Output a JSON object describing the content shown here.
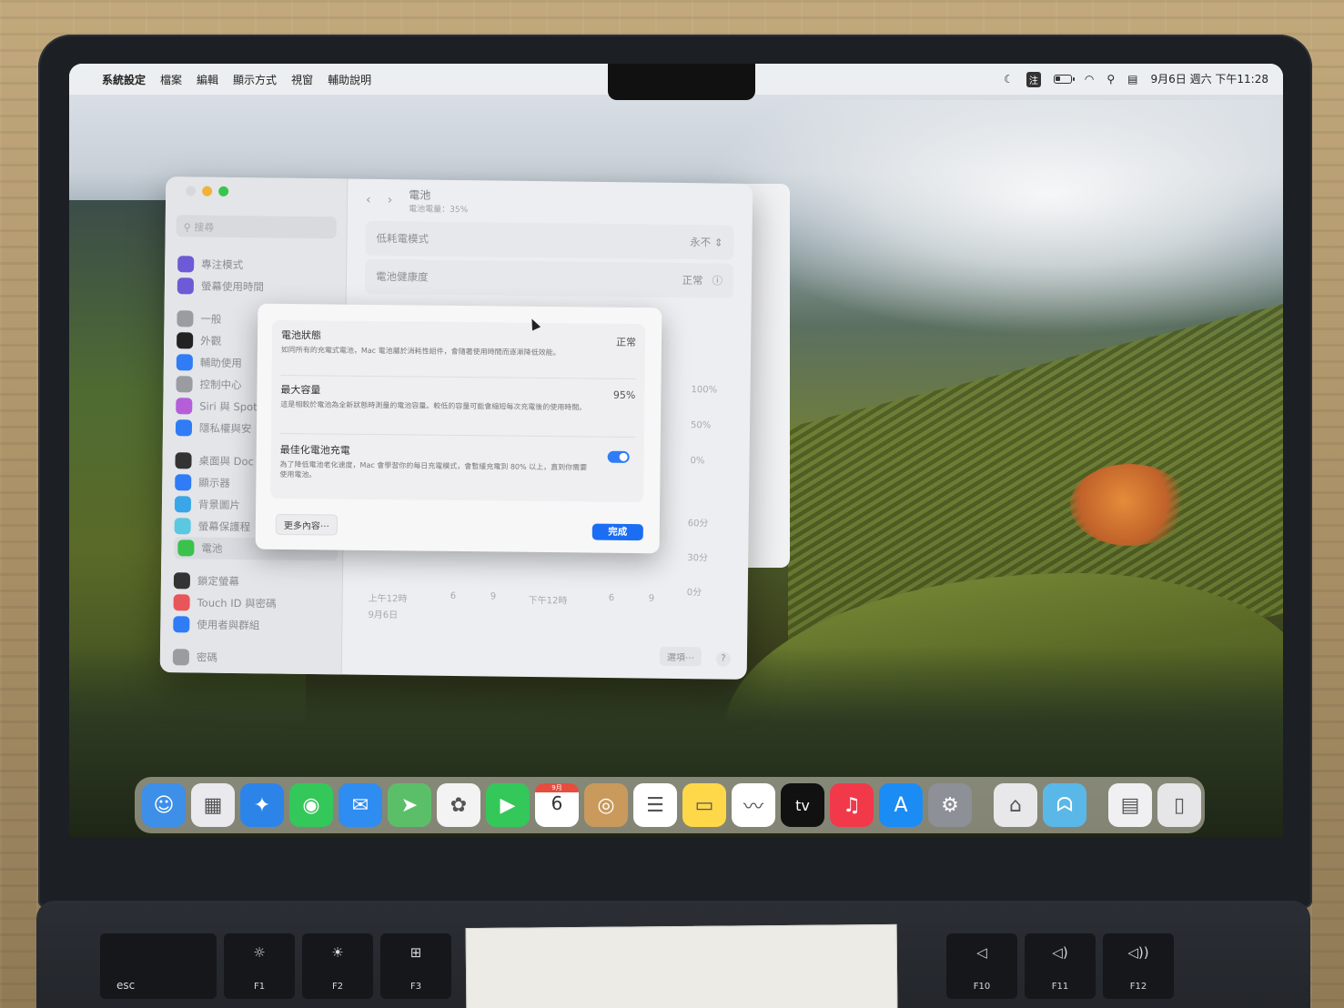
{
  "menubar": {
    "apple_icon": "apple-icon",
    "app_name": "系統設定",
    "menus": [
      "檔案",
      "編輯",
      "顯示方式",
      "視窗",
      "輔助說明"
    ],
    "ime_label": "注",
    "clock": "9月6日 週六 下午11:28"
  },
  "settings": {
    "search_placeholder": "搜尋",
    "sidebar_items": [
      {
        "label": "專注模式",
        "color": "#6b5bd6"
      },
      {
        "label": "螢幕使用時間",
        "color": "#6b5bd6"
      },
      {
        "label": "一般",
        "color": "#9a9ca2"
      },
      {
        "label": "外觀",
        "color": "#222222"
      },
      {
        "label": "輔助使用",
        "color": "#2f7cf6"
      },
      {
        "label": "控制中心",
        "color": "#9a9ca2"
      },
      {
        "label": "Siri 與 Spotl",
        "color": "#b45fd8"
      },
      {
        "label": "隱私權與安",
        "color": "#2f7cf6"
      },
      {
        "label": "桌面與 Doc",
        "color": "#333333"
      },
      {
        "label": "顯示器",
        "color": "#2f7cf6"
      },
      {
        "label": "背景圖片",
        "color": "#3aa6e8"
      },
      {
        "label": "螢幕保護程",
        "color": "#5ac8e0"
      },
      {
        "label": "電池",
        "color": "#3ac24c"
      },
      {
        "label": "鎖定螢幕",
        "color": "#333333"
      },
      {
        "label": "Touch ID 與密碼",
        "color": "#e8565a"
      },
      {
        "label": "使用者與群組",
        "color": "#2f7cf6"
      },
      {
        "label": "密碼",
        "color": "#9a9ca2"
      }
    ],
    "title": "電池",
    "subtitle": "電池電量：35%",
    "low_power_label": "低耗電模式",
    "low_power_value": "永不",
    "health_label": "電池健康度",
    "health_value": "正常",
    "chart_pct_labels": [
      "100%",
      "50%",
      "0%"
    ],
    "chart_min_labels": [
      "60分",
      "30分",
      "0分"
    ],
    "chart_time_labels": [
      "上午12時",
      "6",
      "9",
      "下午12時",
      "6",
      "9"
    ],
    "chart_date": "9月6日",
    "options_label": "選項⋯",
    "help_label": "?"
  },
  "sheet": {
    "status_title": "電池狀態",
    "status_desc": "如同所有的充電式電池，Mac 電池屬於消耗性組件，會隨著使用時間而逐漸降低效能。",
    "status_value": "正常",
    "capacity_title": "最大容量",
    "capacity_desc": "這是相較於電池為全新狀態時測量的電池容量。較低的容量可能會縮短每次充電後的使用時間。",
    "capacity_value": "95%",
    "optimized_title": "最佳化電池充電",
    "optimized_desc": "為了降低電池老化速度，Mac 會學習你的每日充電模式，會暫緩充電到 80% 以上，直到你需要使用電池。",
    "optimized_on": true,
    "more_label": "更多內容⋯",
    "done_label": "完成"
  },
  "dock": {
    "apps": [
      {
        "name": "finder-icon",
        "glyph": "☺",
        "bg": "#3d8fe8"
      },
      {
        "name": "launchpad-icon",
        "glyph": "▦",
        "bg": "#e9e9ee"
      },
      {
        "name": "safari-icon",
        "glyph": "✦",
        "bg": "#2d84e8"
      },
      {
        "name": "messages-icon",
        "glyph": "◉",
        "bg": "#34c759"
      },
      {
        "name": "mail-icon",
        "glyph": "✉",
        "bg": "#2f8cf0"
      },
      {
        "name": "maps-icon",
        "glyph": "➤",
        "bg": "#5bbf6a"
      },
      {
        "name": "photos-icon",
        "glyph": "✿",
        "bg": "#f3f3f3"
      },
      {
        "name": "facetime-icon",
        "glyph": "▶",
        "bg": "#34c759"
      },
      {
        "name": "calendar-icon",
        "glyph": "6",
        "bg": "#ffffff"
      },
      {
        "name": "contacts-icon",
        "glyph": "◎",
        "bg": "#c99a5c"
      },
      {
        "name": "reminders-icon",
        "glyph": "☰",
        "bg": "#ffffff"
      },
      {
        "name": "notes-icon",
        "glyph": "▭",
        "bg": "#ffd84a"
      },
      {
        "name": "freeform-icon",
        "glyph": "〰",
        "bg": "#ffffff"
      },
      {
        "name": "apple-tv-icon",
        "glyph": "tv",
        "bg": "#111111"
      },
      {
        "name": "music-icon",
        "glyph": "♫",
        "bg": "#f2394a"
      },
      {
        "name": "app-store-icon",
        "glyph": "A",
        "bg": "#1c8cf5"
      },
      {
        "name": "system-settings-icon",
        "glyph": "⚙",
        "bg": "#8d9096"
      },
      {
        "name": "utility-icon",
        "glyph": "⌂",
        "bg": "#e8e8ea"
      },
      {
        "name": "rabbit-app-icon",
        "glyph": "ᗣ",
        "bg": "#5ab8e8"
      },
      {
        "name": "document-icon",
        "glyph": "▤",
        "bg": "#f0f0f2"
      },
      {
        "name": "trash-icon",
        "glyph": "▯",
        "bg": "#e6e6e8"
      }
    ],
    "calendar_month": "9月"
  },
  "keyboard": {
    "keys": [
      {
        "sym": "",
        "label": "esc"
      },
      {
        "sym": "☼",
        "label": "F1"
      },
      {
        "sym": "☀",
        "label": "F2"
      },
      {
        "sym": "⊞",
        "label": "F3"
      }
    ],
    "right_keys": [
      {
        "sym": "◁",
        "label": "F10"
      },
      {
        "sym": "◁)",
        "label": "F11"
      },
      {
        "sym": "◁))",
        "label": "F12"
      }
    ]
  }
}
